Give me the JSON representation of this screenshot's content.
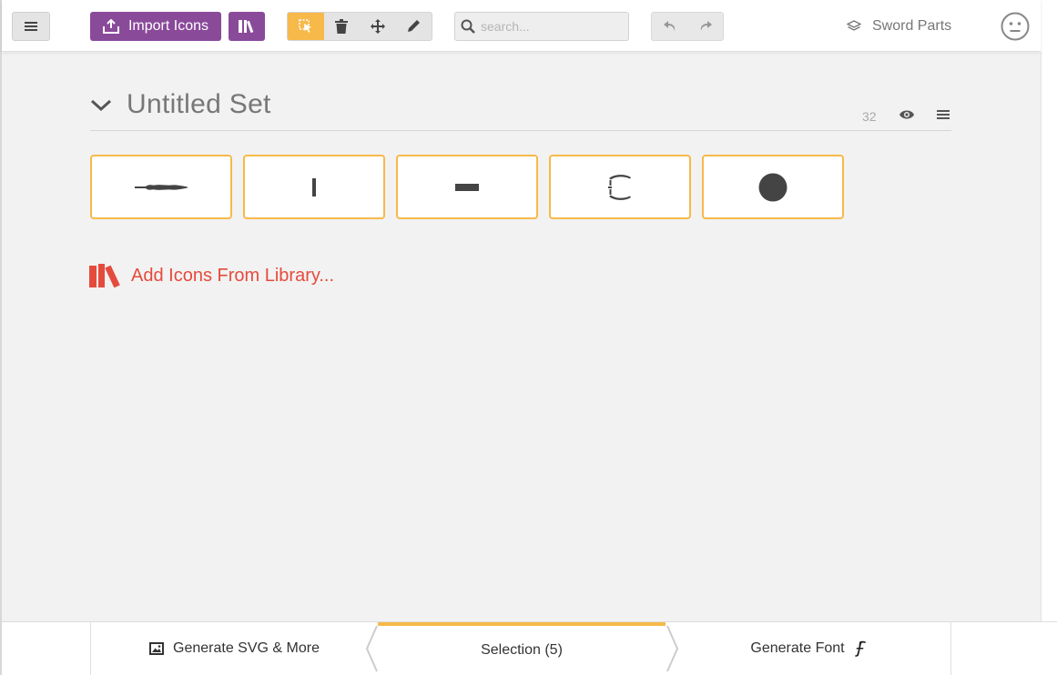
{
  "toolbar": {
    "import_label": "Import Icons",
    "search_placeholder": "search...",
    "project_name": "Sword Parts"
  },
  "set": {
    "title": "Untitled Set",
    "count": "32"
  },
  "icons": [
    "blade",
    "grip",
    "crossguard",
    "handguard",
    "pommel"
  ],
  "add_library_label": "Add Icons From Library...",
  "footer": {
    "svg_label": "Generate SVG & More",
    "selection_label": "Selection (5)",
    "font_label": "Generate Font"
  },
  "colors": {
    "purple": "#8a4a9a",
    "accent": "#f7b94a",
    "red": "#e54b3c"
  }
}
